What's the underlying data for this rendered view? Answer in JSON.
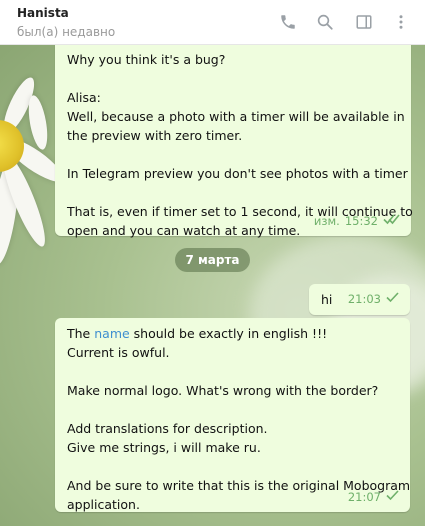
{
  "header": {
    "title": "Hanista",
    "status": "был(а) недавно",
    "icons": [
      "phone-icon",
      "search-icon",
      "sidebar-toggle-icon",
      "more-vert-icon"
    ]
  },
  "messages": [
    {
      "id": "m1",
      "direction": "outgoing",
      "lines": [
        "Why you think it's a bug?",
        "",
        "Alisa:",
        "Well, because a photo with a timer will be available in",
        "the preview with zero timer.",
        "",
        "In Telegram preview you don't see photos with a timer",
        "",
        "That is, even if timer set to 1 second, it will continue to",
        "open and you can watch at any time."
      ],
      "edited_label": "изм.",
      "time": "15:32",
      "status": "read"
    },
    {
      "id": "m2",
      "direction": "outgoing",
      "text": "hi",
      "time": "21:03",
      "status": "sent"
    },
    {
      "id": "m3",
      "direction": "outgoing",
      "line1_pre": "The ",
      "line1_link": "name",
      "line1_post": " should be exactly in english !!!",
      "lines": [
        "Current is owful.",
        "",
        "Make normal logo. What's wrong with the border?",
        "",
        "Add translations for description.",
        "Give me strings, i will make ru.",
        "",
        "And be sure to write that this is the original Mobogram",
        "application."
      ],
      "time": "21:07",
      "status": "sent"
    }
  ],
  "date_separator": "7 марта",
  "colors": {
    "bubble_out": "#effdde",
    "meta_green": "#6fb06a",
    "link": "#3f8fd0",
    "header_bg": "#ffffff"
  }
}
